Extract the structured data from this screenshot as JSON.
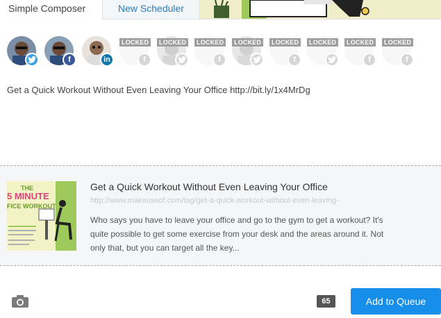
{
  "tabs": {
    "simple": "Simple Composer",
    "new": "New Scheduler"
  },
  "profiles": [
    {
      "network": "twitter",
      "locked": false
    },
    {
      "network": "facebook",
      "locked": false
    },
    {
      "network": "linkedin",
      "locked": false
    },
    {
      "network": "facebook",
      "locked": true,
      "locked_label": "LOCKED"
    },
    {
      "network": "twitter",
      "locked": true,
      "locked_label": "LOCKED"
    },
    {
      "network": "facebook",
      "locked": true,
      "locked_label": "LOCKED"
    },
    {
      "network": "twitter",
      "locked": true,
      "locked_label": "LOCKED"
    },
    {
      "network": "facebook",
      "locked": true,
      "locked_label": "LOCKED"
    },
    {
      "network": "twitter",
      "locked": true,
      "locked_label": "LOCKED"
    },
    {
      "network": "facebook",
      "locked": true,
      "locked_label": "LOCKED"
    },
    {
      "network": "facebook",
      "locked": true,
      "locked_label": "LOCKED"
    }
  ],
  "composer": {
    "text": "Get a Quick Workout Without Even Leaving Your Office http://bit.ly/1x4MrDg"
  },
  "preview": {
    "title": "Get a Quick Workout Without Even Leaving Your Office",
    "url": "http://www.makeuseof.com/tag/get-a-quick-workout-without-even-leaving-",
    "description": "Who says you have to leave your office and go to the gym to get a workout? It's quite possible to get some exercise from your desk and the areas around it. Not only that, but you can target all the key...",
    "thumb_line1": "THE",
    "thumb_line2": "5 MINUTE",
    "thumb_line3": "FICE WORKOUT"
  },
  "footer": {
    "char_count": "65",
    "add_button": "Add to Queue"
  },
  "colors": {
    "accent": "#168eea",
    "twitter": "#3aa0e3",
    "facebook": "#3b5998",
    "linkedin": "#0e76a8"
  },
  "icons": {
    "camera": "camera-icon",
    "twitter": "twitter-icon",
    "facebook": "facebook-icon",
    "linkedin": "linkedin-icon"
  }
}
